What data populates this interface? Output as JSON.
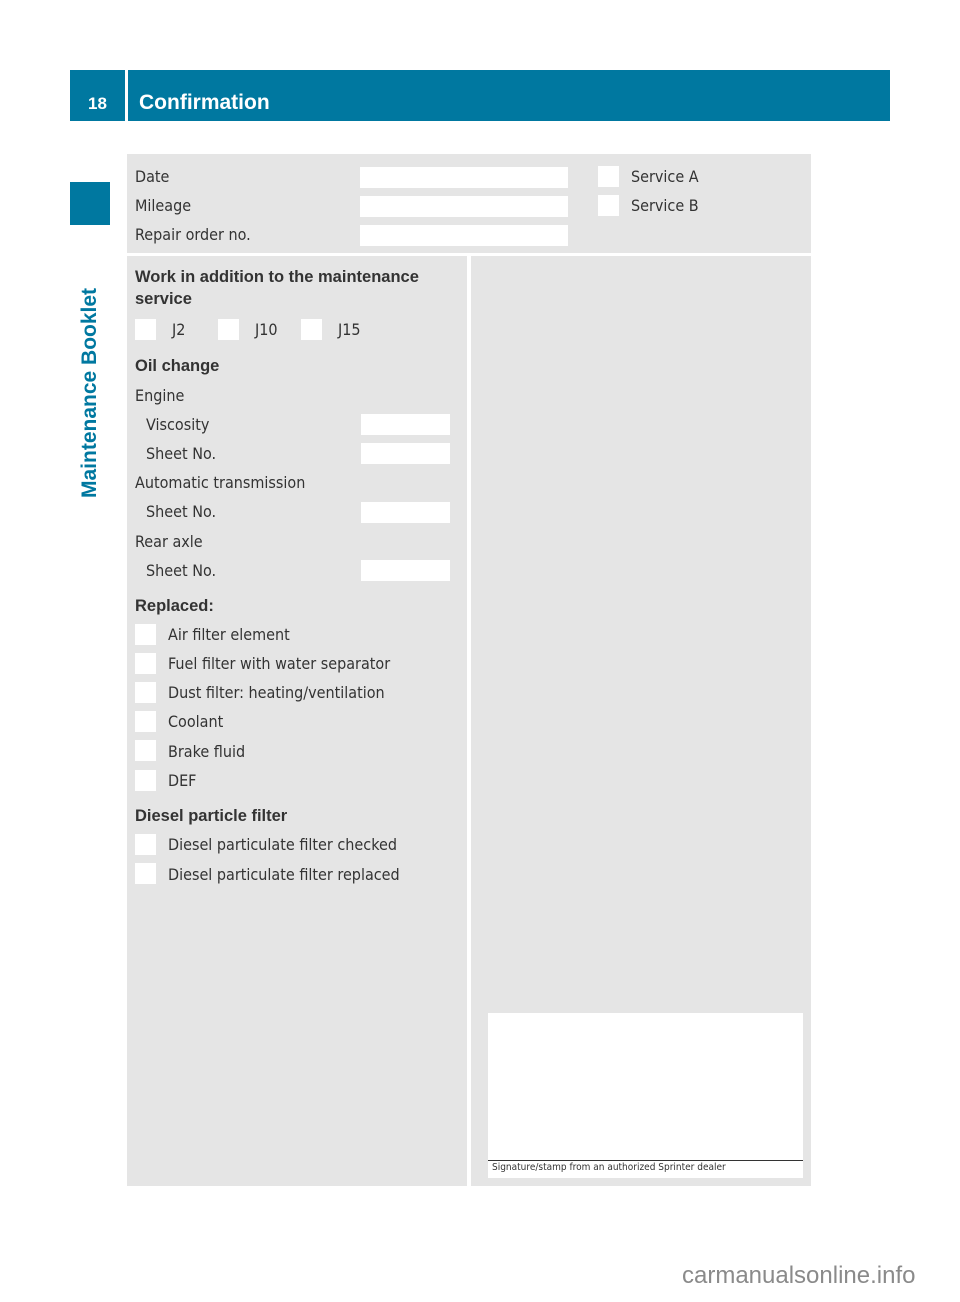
{
  "header": {
    "page_number": "18",
    "title": "Confirmation",
    "accent_color": "#0078a0"
  },
  "side_label": "Maintenance Booklet",
  "service_info": {
    "fields": [
      {
        "label": "Date",
        "value": ""
      },
      {
        "label": "Mileage",
        "value": ""
      },
      {
        "label": "Repair order no.",
        "value": ""
      }
    ],
    "services": [
      {
        "label": "Service A",
        "checked": false
      },
      {
        "label": "Service B",
        "checked": false
      }
    ]
  },
  "additional_work": {
    "heading": "Work in addition to the maintenance service",
    "heading_line1": "Work in addition to the maintenance",
    "heading_line2": "service",
    "options": [
      {
        "label": "J2",
        "checked": false
      },
      {
        "label": "J10",
        "checked": false
      },
      {
        "label": "J15",
        "checked": false
      }
    ]
  },
  "oil_change": {
    "heading": "Oil change",
    "engine": {
      "label": "Engine",
      "viscosity_label": "Viscosity",
      "viscosity_value": "",
      "sheet_label": "Sheet No.",
      "sheet_value": ""
    },
    "automatic_transmission": {
      "label": "Automatic transmission",
      "sheet_label": "Sheet No.",
      "sheet_value": ""
    },
    "rear_axle": {
      "label": "Rear axle",
      "sheet_label": "Sheet No.",
      "sheet_value": ""
    }
  },
  "replaced": {
    "heading": "Replaced:",
    "items": [
      {
        "label": "Air filter element",
        "checked": false
      },
      {
        "label": "Fuel filter with water separator",
        "checked": false
      },
      {
        "label": "Dust filter: heating/ventilation",
        "checked": false
      },
      {
        "label": "Coolant",
        "checked": false
      },
      {
        "label": "Brake fluid",
        "checked": false
      },
      {
        "label": "DEF",
        "checked": false
      }
    ]
  },
  "dpf": {
    "heading": "Diesel particle filter",
    "items": [
      {
        "label": "Diesel particulate filter checked",
        "checked": false
      },
      {
        "label": "Diesel particulate filter replaced",
        "checked": false
      }
    ]
  },
  "signature": {
    "caption": "Signature/stamp from an authorized Sprinter dealer"
  },
  "watermark": "carmanualsonline.info"
}
